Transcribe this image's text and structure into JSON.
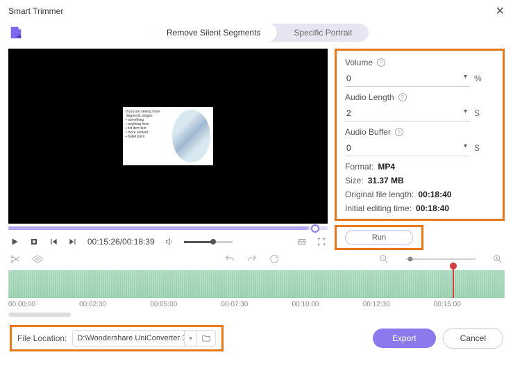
{
  "window": {
    "title": "Smart Trimmer"
  },
  "tabs": {
    "remove_silent": "Remove Silent Segments",
    "specific_portrait": "Specific Portrait"
  },
  "player": {
    "current": "00:15:26",
    "total": "00:18:39"
  },
  "settings": {
    "volume_label": "Volume",
    "volume_value": "0",
    "volume_unit": "%",
    "audio_length_label": "Audio Length",
    "audio_length_value": "2",
    "audio_length_unit": "S",
    "audio_buffer_label": "Audio Buffer",
    "audio_buffer_value": "0",
    "audio_buffer_unit": "S",
    "format_label": "Format:",
    "format_value": "MP4",
    "size_label": "Size:",
    "size_value": "31.37 MB",
    "orig_len_label": "Original file length:",
    "orig_len_value": "00:18:40",
    "init_time_label": "Initial editing time:",
    "init_time_value": "00:18:40"
  },
  "run_label": "Run",
  "ruler": [
    "00:00:00",
    "00:02:30",
    "00:05:00",
    "00:07:30",
    "00:10:00",
    "00:12:30",
    "00:15:00"
  ],
  "file_location": {
    "label": "File Location:",
    "path": "D:\\Wondershare UniConverter 1"
  },
  "buttons": {
    "export": "Export",
    "cancel": "Cancel"
  }
}
